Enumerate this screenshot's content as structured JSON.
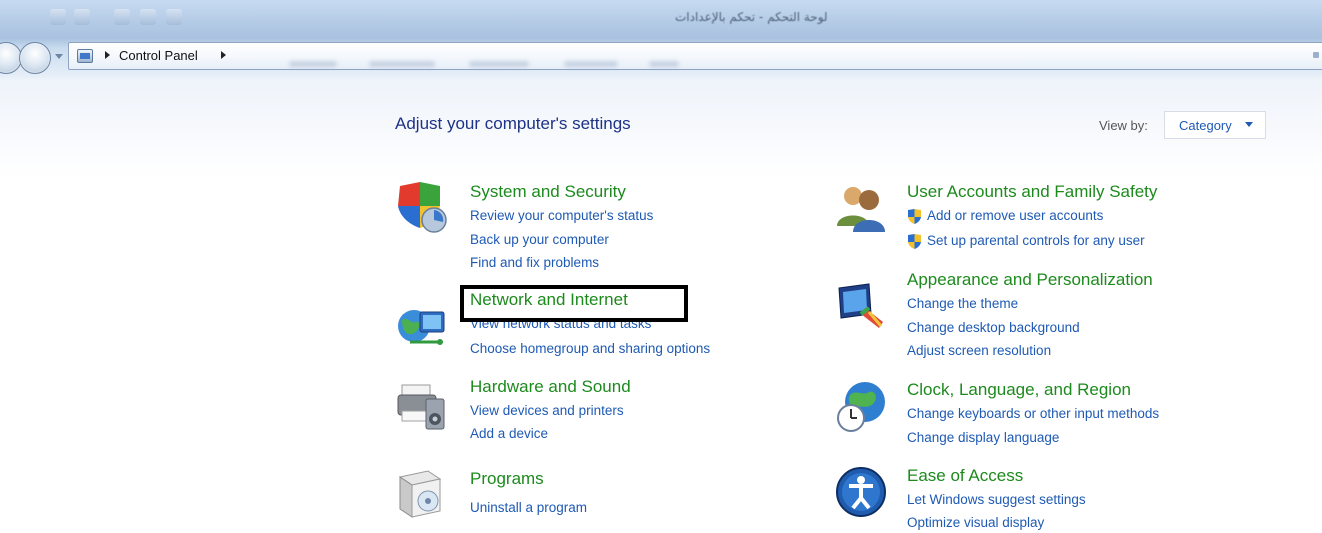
{
  "window": {
    "title": "لوحة التحكم - تحكم بالإعدادات"
  },
  "addressbar": {
    "breadcrumb": [
      "Control Panel"
    ]
  },
  "content": {
    "heading": "Adjust your computer's settings",
    "view_by_label": "View by:",
    "view_by_value": "Category",
    "categories_left": [
      {
        "title": "System and Security",
        "icon": "shield-icon",
        "links": [
          "Review your computer's status",
          "Back up your computer",
          "Find and fix problems"
        ]
      },
      {
        "title": "Network and Internet",
        "icon": "network-globe-icon",
        "links": [
          "View network status and tasks",
          "Choose homegroup and sharing options"
        ]
      },
      {
        "title": "Hardware and Sound",
        "icon": "printer-speaker-icon",
        "links": [
          "View devices and printers",
          "Add a device"
        ]
      },
      {
        "title": "Programs",
        "icon": "programs-box-icon",
        "links": [
          "Uninstall a program"
        ]
      }
    ],
    "categories_right": [
      {
        "title": "User Accounts and Family Safety",
        "icon": "users-icon",
        "links": [
          "Add or remove user accounts",
          "Set up parental controls for any user"
        ]
      },
      {
        "title": "Appearance and Personalization",
        "icon": "monitor-brush-icon",
        "links": [
          "Change the theme",
          "Change desktop background",
          "Adjust screen resolution"
        ]
      },
      {
        "title": "Clock, Language, and Region",
        "icon": "globe-clock-icon",
        "links": [
          "Change keyboards or other input methods",
          "Change display language"
        ]
      },
      {
        "title": "Ease of Access",
        "icon": "ease-of-access-icon",
        "links": [
          "Let Windows suggest settings",
          "Optimize visual display"
        ]
      }
    ]
  },
  "colors": {
    "heading": "#1e3287",
    "category_title": "#1d8a1d",
    "link": "#1e5ab4",
    "highlight_border": "#000000"
  }
}
